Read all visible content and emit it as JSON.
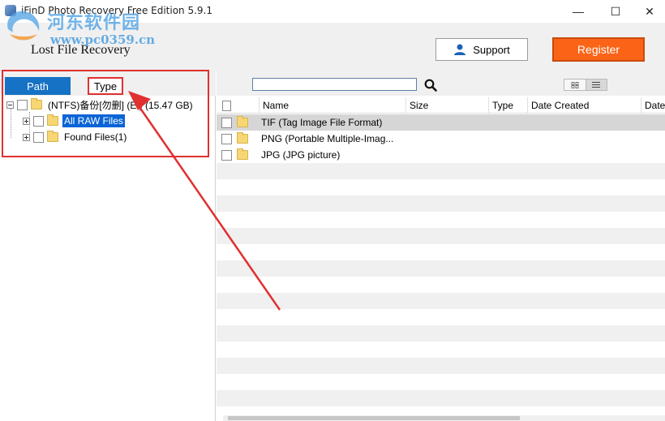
{
  "window": {
    "title": "iFinD Photo Recovery Free Edition 5.9.1",
    "minimize_glyph": "—",
    "maximize_glyph": "☐",
    "close_glyph": "✕"
  },
  "watermark": {
    "site_name": "河东软件园",
    "url": "www.pc0359.cn"
  },
  "header": {
    "title": "Lost File Recovery",
    "support_label": "Support",
    "register_label": "Register"
  },
  "tabs": [
    {
      "label": "Path",
      "active": true
    },
    {
      "label": "Type",
      "active": false
    }
  ],
  "tree": {
    "root": "(NTFS)备份[勿删] (E:) (15.47 GB)",
    "children": [
      {
        "label": "All RAW Files",
        "selected": true
      },
      {
        "label": "Found Files(1)",
        "selected": false
      }
    ]
  },
  "search": {
    "value": "",
    "placeholder": ""
  },
  "table": {
    "columns": [
      "Name",
      "Size",
      "Type",
      "Date Created",
      "Date"
    ],
    "rows": [
      {
        "name": "TIF (Tag Image File Format)",
        "selected": true
      },
      {
        "name": "PNG (Portable Multiple-Imag...",
        "selected": false
      },
      {
        "name": "JPG (JPG picture)",
        "selected": false
      }
    ]
  },
  "colors": {
    "accent_blue": "#1672c4",
    "register_orange": "#fb6417",
    "annotation_red": "#e03030",
    "selection_blue": "#0a64d6"
  }
}
